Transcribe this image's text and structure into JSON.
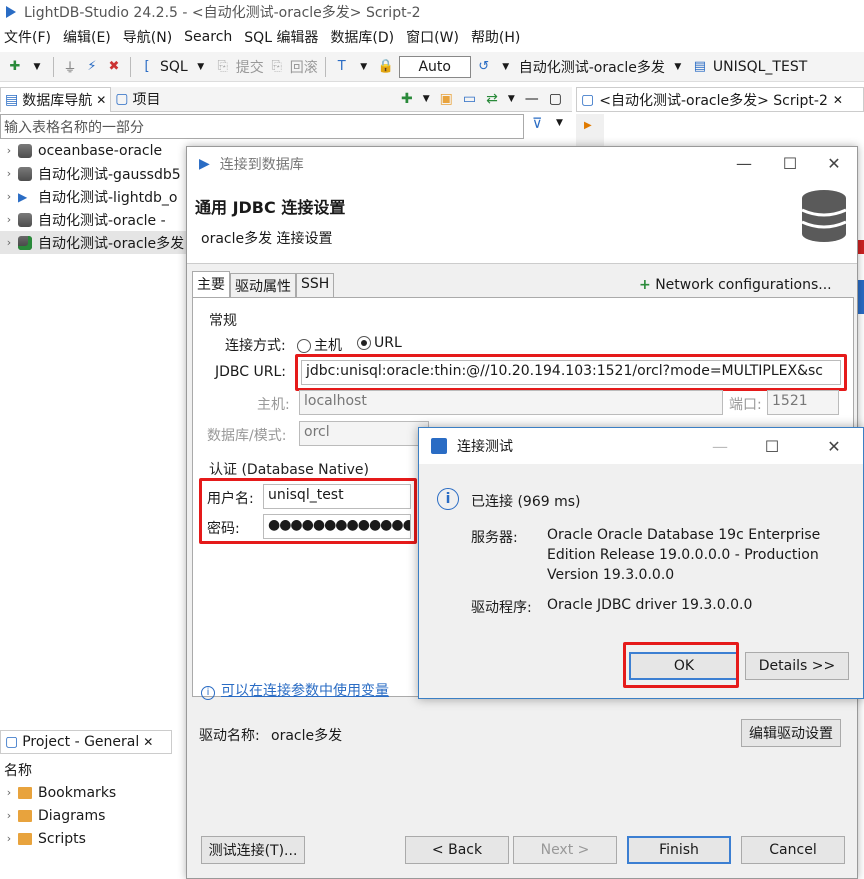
{
  "app": {
    "title": "LightDB-Studio 24.2.5 - <自动化测试-oracle多发> Script-2"
  },
  "menu": [
    "文件(F)",
    "编辑(E)",
    "导航(N)",
    "Search",
    "SQL 编辑器",
    "数据库(D)",
    "窗口(W)",
    "帮助(H)"
  ],
  "toolbar": {
    "sql": "SQL",
    "commit": "提交",
    "rollback": "回滚",
    "auto": "Auto",
    "connection": "自动化测试-oracle多发",
    "schema": "UNISQL_TEST"
  },
  "nav": {
    "tab_db": "数据库导航",
    "tab_project": "项目",
    "search_placeholder": "输入表格名称的一部分",
    "items": [
      {
        "label": "oceanbase-oracle"
      },
      {
        "label": "自动化测试-gaussdb5"
      },
      {
        "label": "自动化测试-lightdb_o"
      },
      {
        "label": "自动化测试-oracle  -"
      },
      {
        "label": "自动化测试-oracle多发"
      }
    ]
  },
  "editor_tab": "<自动化测试-oracle多发> Script-2",
  "project": {
    "tab": "Project - General",
    "header": "名称",
    "items": [
      "Bookmarks",
      "Diagrams",
      "Scripts"
    ]
  },
  "connect": {
    "window_title": "连接到数据库",
    "header_title": "通用 JDBC 连接设置",
    "header_sub": "oracle多发 连接设置",
    "tabs": [
      "主要",
      "驱动属性",
      "SSH"
    ],
    "network": "Network configurations...",
    "group_general": "常规",
    "conn_method_label": "连接方式:",
    "radio_host": "主机",
    "radio_url": "URL",
    "jdbc_label": "JDBC URL:",
    "jdbc_value": "jdbc:unisql:oracle:thin:@//10.20.194.103:1521/orcl?mode=MULTIPLEX&sc",
    "host_label": "主机:",
    "host_value": "localhost",
    "port_label": "端口:",
    "port_value": "1521",
    "db_label": "数据库/模式:",
    "db_value": "orcl",
    "group_auth": "认证 (Database Native)",
    "user_label": "用户名:",
    "user_value": "unisql_test",
    "pass_label": "密码:",
    "pass_value": "●●●●●●●●●●●●●●",
    "hint": "可以在连接参数中使用变量",
    "driver_label": "驱动名称:",
    "driver_value": "oracle多发",
    "edit_driver": "编辑驱动设置",
    "btn_test": "测试连接(T)...",
    "btn_back": "< Back",
    "btn_next": "Next >",
    "btn_finish": "Finish",
    "btn_cancel": "Cancel"
  },
  "test": {
    "title": "连接测试",
    "status": "已连接 (969 ms)",
    "server_label": "服务器:",
    "server_value1": "Oracle Oracle Database 19c Enterprise",
    "server_value2": "Edition Release 19.0.0.0.0 - Production",
    "server_value3": "Version 19.3.0.0.0",
    "driver_label": "驱动程序:",
    "driver_value": "Oracle JDBC driver 19.3.0.0.0",
    "ok": "OK",
    "details": "Details >>"
  },
  "colors": {
    "highlight": "#e51a1a",
    "accent": "#2a6cc4"
  }
}
